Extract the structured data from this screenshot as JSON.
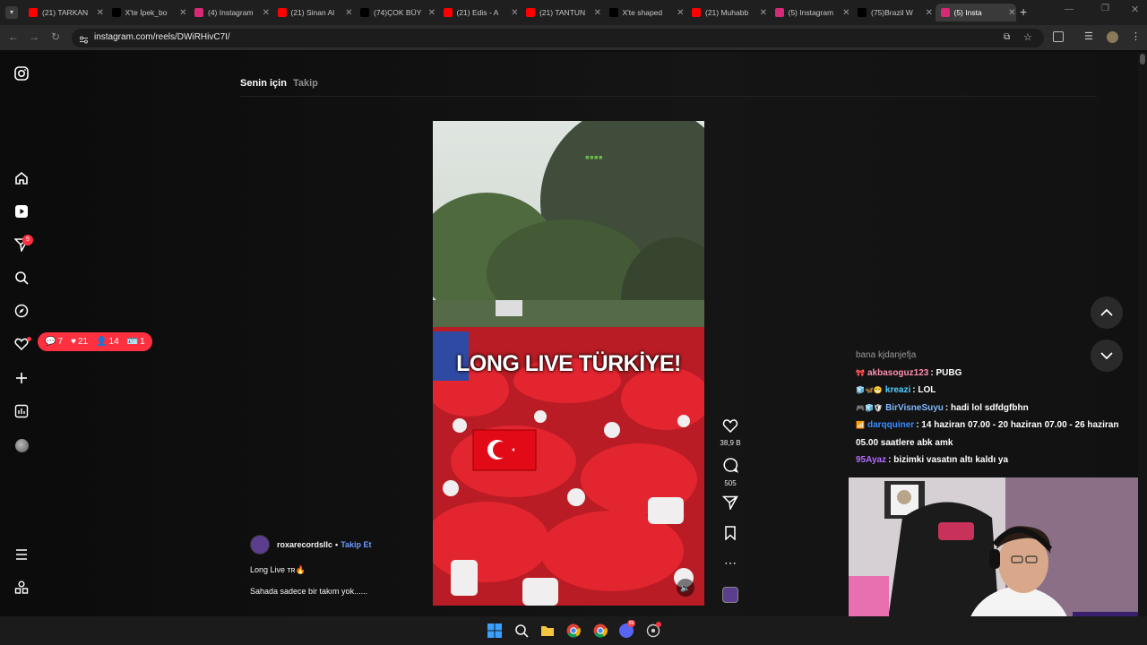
{
  "browser": {
    "tabs": [
      {
        "title": "(21) TARKAN",
        "favicon": "youtube-icon",
        "color": "#ff0000"
      },
      {
        "title": "X'te İpek_bo",
        "favicon": "x-icon",
        "color": "#000000"
      },
      {
        "title": "(4) Instagram",
        "favicon": "instagram-icon",
        "color": "#d62976"
      },
      {
        "title": "(21) Sinan Al",
        "favicon": "youtube-icon",
        "color": "#ff0000"
      },
      {
        "title": "(74)ÇOK BÜY",
        "favicon": "tiktok-icon",
        "color": "#000000"
      },
      {
        "title": "(21) Edis - A",
        "favicon": "youtube-icon",
        "color": "#ff0000"
      },
      {
        "title": "(21) TANTUN",
        "favicon": "youtube-icon",
        "color": "#ff0000"
      },
      {
        "title": "X'te shaped",
        "favicon": "x-icon",
        "color": "#000000"
      },
      {
        "title": "(21) Muhabb",
        "favicon": "youtube-icon",
        "color": "#ff0000"
      },
      {
        "title": "(5) Instagram",
        "favicon": "instagram-icon",
        "color": "#d62976"
      },
      {
        "title": "(75)Brazil W",
        "favicon": "tiktok-icon",
        "color": "#000000"
      },
      {
        "title": "(5) Insta",
        "favicon": "instagram-icon",
        "color": "#d62976",
        "active": true
      }
    ],
    "new_tab": "+",
    "url": "instagram.com/reels/DWiRHivC7I/"
  },
  "instagram": {
    "feed_tabs": {
      "for_you": "Senin için",
      "following": "Takip"
    },
    "notifications": {
      "comments": "7",
      "likes": "21",
      "follows": "14",
      "mentions": "1"
    },
    "messages_badge": "5",
    "reel": {
      "caption_overlay": "LONG LIVE TÜRKİYE!",
      "likes": "38,9 B",
      "comments": "505",
      "author": "roxarecordsllc",
      "follow_label": "Takip Et",
      "separator": "•",
      "description_line1": "Long Live ᴛʀ🔥",
      "description_line2": "Sahada sadece bir takım yok......"
    }
  },
  "chat": {
    "messages": [
      {
        "user": "",
        "text": "bana kjdanjefja",
        "color": "#9a9a9a",
        "partial": true
      },
      {
        "user": "akbasoguz123",
        "text": ": PUBG",
        "color": "#ff8fb0",
        "badges": "🎀"
      },
      {
        "user": "kreazi",
        "text": ": LOL",
        "color": "#4fd1ff",
        "badges": "🧊🦋😁"
      },
      {
        "user": "BirVisneSuyu",
        "text": ": hadi lol sdfdgfbhn",
        "color": "#7fb8ff",
        "badges": "🎮🧊🛡"
      },
      {
        "user": "darqquiner",
        "text": ": 14 haziran 07.00 - 20 haziran 07.00 - 26 haziran 05.00 saatlere abk amk",
        "color": "#3a8bff",
        "badges": "📶"
      },
      {
        "user": "95Ayaz",
        "text": ": bizimki vasatın altı kaldı ya",
        "color": "#b46cff",
        "badges": ""
      }
    ]
  }
}
